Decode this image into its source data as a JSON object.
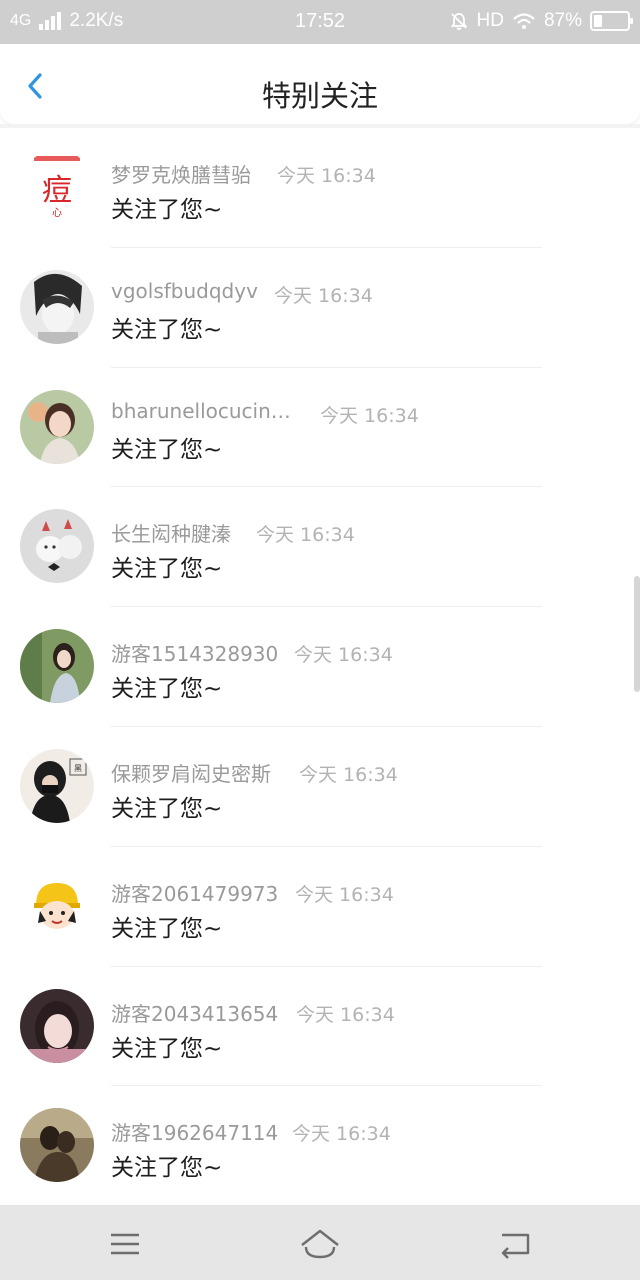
{
  "status_bar": {
    "network": "4G",
    "speed": "2.2K/s",
    "time": "17:52",
    "hd": "HD",
    "battery": "87%"
  },
  "header": {
    "title": "特别关注",
    "back_icon": "chevron-left-icon"
  },
  "colors": {
    "accent": "#2f95e0",
    "name_text": "#9a9a9a",
    "time_text": "#b3b3b3",
    "message_text": "#1e1e1e"
  },
  "notifications": [
    {
      "name": "梦罗克焕膳彗骀",
      "time": "今天 16:34",
      "message": "关注了您~"
    },
    {
      "name": "vgolsfbudqdyv",
      "time": "今天 16:34",
      "message": "关注了您~"
    },
    {
      "name": "bharunellocucin…",
      "time": "今天 16:34",
      "message": "关注了您~"
    },
    {
      "name": "长生闳种腱溱",
      "time": "今天 16:34",
      "message": "关注了您~"
    },
    {
      "name": "游客1514328930",
      "time": "今天 16:34",
      "message": "关注了您~"
    },
    {
      "name": "保颗罗肩闳史密斯",
      "time": "今天 16:34",
      "message": "关注了您~"
    },
    {
      "name": "游客2061479973",
      "time": "今天 16:34",
      "message": "关注了您~"
    },
    {
      "name": "游客2043413654",
      "time": "今天 16:34",
      "message": "关注了您~"
    },
    {
      "name": "游客1962647114",
      "time": "今天 16:34",
      "message": "关注了您~"
    }
  ],
  "nav_bar": {
    "menu_icon": "menu-icon",
    "home_icon": "home-icon",
    "back_icon": "back-icon"
  }
}
